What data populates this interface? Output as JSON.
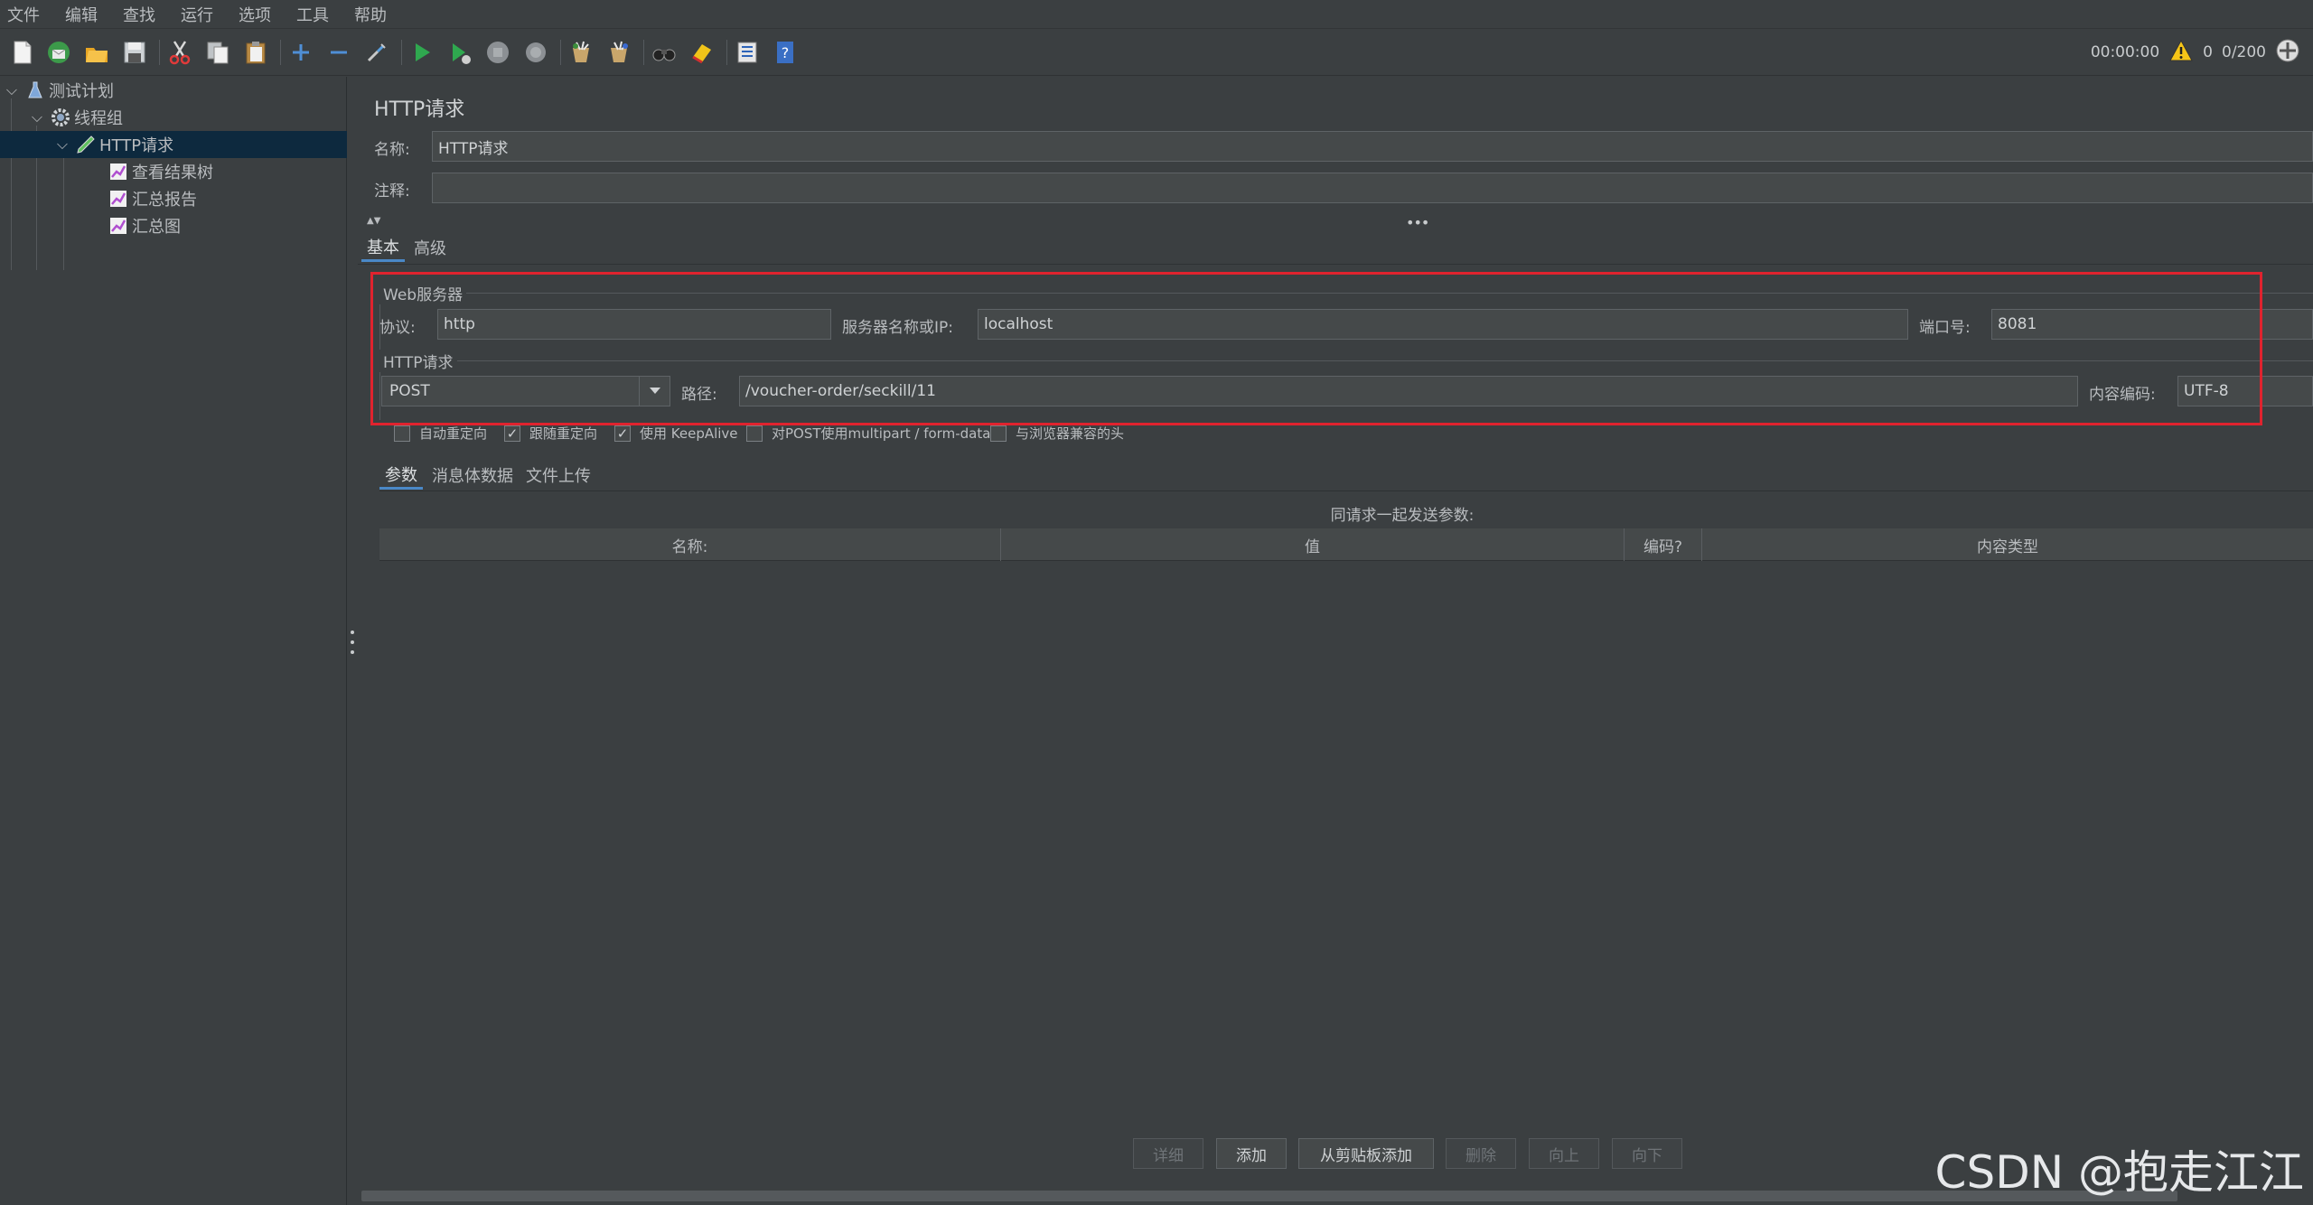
{
  "menubar": {
    "items": [
      "文件",
      "编辑",
      "查找",
      "运行",
      "选项",
      "工具",
      "帮助"
    ]
  },
  "toolbar": {
    "icons": [
      "new-plan-icon",
      "templates-icon",
      "open-icon",
      "save-icon",
      "cut-icon",
      "copy-icon",
      "paste-icon",
      "expand-icon",
      "collapse-icon",
      "toggle-icon",
      "start-icon",
      "start-no-pause-icon",
      "stop-icon",
      "shutdown-icon",
      "clear-icon",
      "clear-all-icon",
      "search-icon",
      "reset-search-icon",
      "function-helper-icon",
      "help-icon"
    ],
    "timer": "00:00:00",
    "warnings": "0",
    "threads": "0/200"
  },
  "tree": {
    "items": [
      {
        "label": "测试计划",
        "icon": "test-plan-icon"
      },
      {
        "label": "线程组",
        "icon": "gear-icon"
      },
      {
        "label": "HTTP请求",
        "icon": "sampler-pen-icon"
      },
      {
        "label": "查看结果树",
        "icon": "listener-chart-icon"
      },
      {
        "label": "汇总报告",
        "icon": "listener-chart-icon"
      },
      {
        "label": "汇总图",
        "icon": "listener-chart-icon"
      }
    ]
  },
  "panel": {
    "title": "HTTP请求",
    "name_label": "名称:",
    "name_value": "HTTP请求",
    "comment_label": "注释:",
    "comment_value": "",
    "tabs": [
      "基本",
      "高级"
    ],
    "web_server": {
      "title": "Web服务器",
      "protocol_label": "协议:",
      "protocol_value": "http",
      "server_label": "服务器名称或IP:",
      "server_value": "localhost",
      "port_label": "端口号:",
      "port_value": "8081"
    },
    "http_request": {
      "title": "HTTP请求",
      "method": "POST",
      "path_label": "路径:",
      "path_value": "/voucher-order/seckill/11",
      "encoding_label": "内容编码:",
      "encoding_value": "UTF-8"
    },
    "checkboxes": [
      {
        "label": "自动重定向",
        "checked": false
      },
      {
        "label": "跟随重定向",
        "checked": true
      },
      {
        "label": "使用 KeepAlive",
        "checked": true
      },
      {
        "label": "对POST使用multipart / form-data",
        "checked": false
      },
      {
        "label": "与浏览器兼容的头",
        "checked": false
      }
    ],
    "sub_tabs": [
      "参数",
      "消息体数据",
      "文件上传"
    ],
    "params_caption": "同请求一起发送参数:",
    "columns": [
      "名称:",
      "值",
      "编码?",
      "内容类型"
    ],
    "buttons": [
      {
        "label": "详细",
        "enabled": false
      },
      {
        "label": "添加",
        "enabled": true
      },
      {
        "label": "从剪贴板添加",
        "enabled": true
      },
      {
        "label": "删除",
        "enabled": false
      },
      {
        "label": "向上",
        "enabled": false
      },
      {
        "label": "向下",
        "enabled": false
      }
    ]
  },
  "watermark": "CSDN @抱走江江",
  "colors": {
    "background": "#3b3f41",
    "selection": "#0d293e",
    "highlight_box": "#e0232e",
    "tab_accent": "#4a88c7"
  }
}
